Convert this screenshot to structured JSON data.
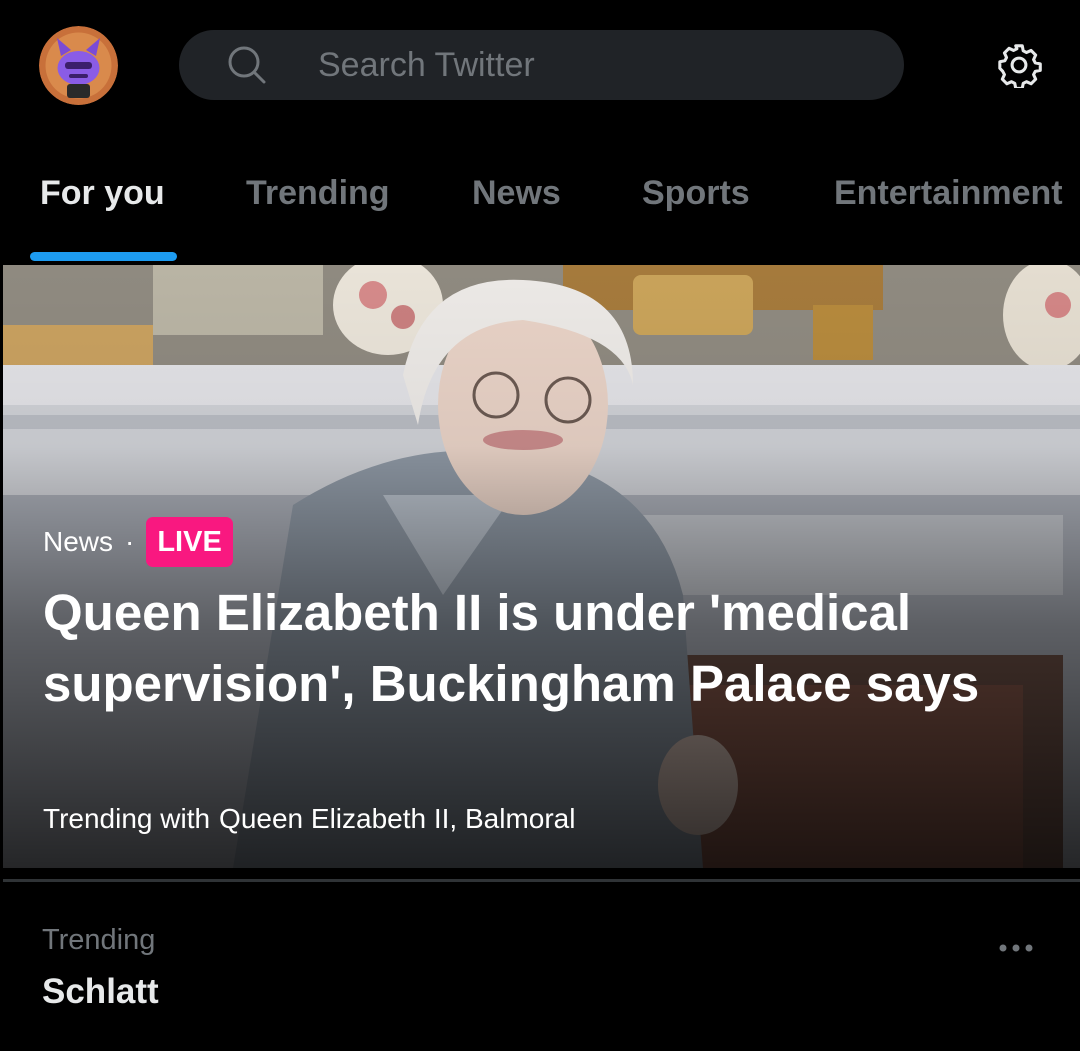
{
  "search": {
    "placeholder": "Search Twitter"
  },
  "tabs": [
    {
      "label": "For you",
      "active": true
    },
    {
      "label": "Trending",
      "active": false
    },
    {
      "label": "News",
      "active": false
    },
    {
      "label": "Sports",
      "active": false
    },
    {
      "label": "Entertainment",
      "active": false
    }
  ],
  "hero": {
    "category": "News",
    "separator": "·",
    "badge": "LIVE",
    "headline": "Queen Elizabeth II is under 'medical supervision', Buckingham Palace says",
    "trending_with_label": "Trending with",
    "trending_with_names": "Queen Elizabeth II, Balmoral"
  },
  "trend": {
    "label": "Trending",
    "title": "Schlatt"
  },
  "icons": {
    "avatar": "avatar-purple-creature",
    "search": "search-icon",
    "settings": "gear-icon",
    "more": "more-horizontal-icon"
  },
  "colors": {
    "background": "#000000",
    "accent": "#1d9bf0",
    "live": "#f91880",
    "muted_text": "#71767b",
    "search_bg": "#202327"
  }
}
